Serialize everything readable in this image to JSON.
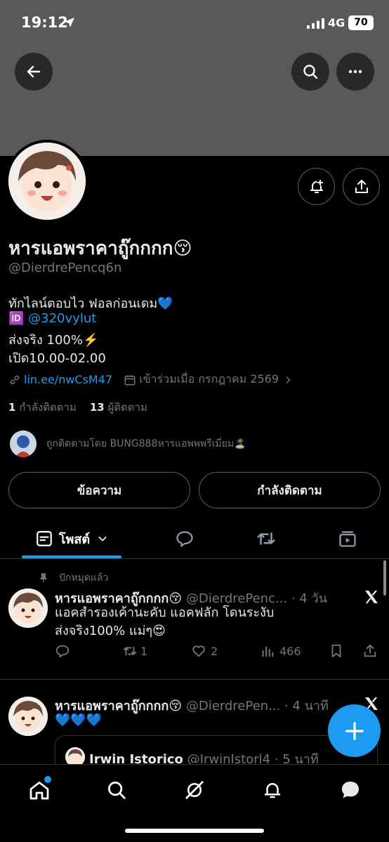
{
  "status_bar": {
    "time": "19:12",
    "network": "4G",
    "battery": "70"
  },
  "profile": {
    "name": "หารแอพราคาถู๊กกกก😚",
    "handle": "@DierdrePencq6n",
    "bio": {
      "line1": "ทักไลน์ตอบไว ฟอลก่อนเดม💙",
      "id_badge": "🆔",
      "line2_link": "@320vylut",
      "line3": "ส่งจริง 100%⚡️",
      "line4": "เปิด10.00-02.00"
    },
    "website": "lin.ee/nwCsM47",
    "joined": "เข้าร่วมเมื่อ กรกฎาคม 2569",
    "following_count": "1",
    "following_label": "กำลังติดตาม",
    "followers_count": "13",
    "followers_label": "ผู้ติดตาม",
    "followed_by": "ถูกติดตามโดย BUNG888หารแอพพพรีเมี่ยม🏝️"
  },
  "buttons": {
    "message": "ข้อความ",
    "following": "กำลังติดตาม"
  },
  "tabs": {
    "posts_label": "โพสต์"
  },
  "pinned_label": "ปักหมุดแล้ว",
  "tweets": [
    {
      "name": "หารแอพราคาถู๊กกกก😚",
      "handle_time": "@DierdrePenc... · 4 วัน",
      "line1": "แอคสำรองเค้านะคับ แอคฟลัก โดนระงับ",
      "line2": "ส่งจริง100% แม่ๆ😍",
      "retweets": "1",
      "likes": "2",
      "views": "466"
    },
    {
      "name": "หารแอพราคาถู๊กกกก😚",
      "handle_time": "@DierdrePen... · 4 นาที",
      "line1": "💙💙💙",
      "quote": {
        "name": "Irwin Istorico",
        "handle_time": "@IrwinIstorl4 · 5 นาที"
      }
    }
  ],
  "colors": {
    "accent": "#1d9bf0",
    "muted": "#71767b",
    "border": "#2f3336",
    "banner": "#595959"
  }
}
